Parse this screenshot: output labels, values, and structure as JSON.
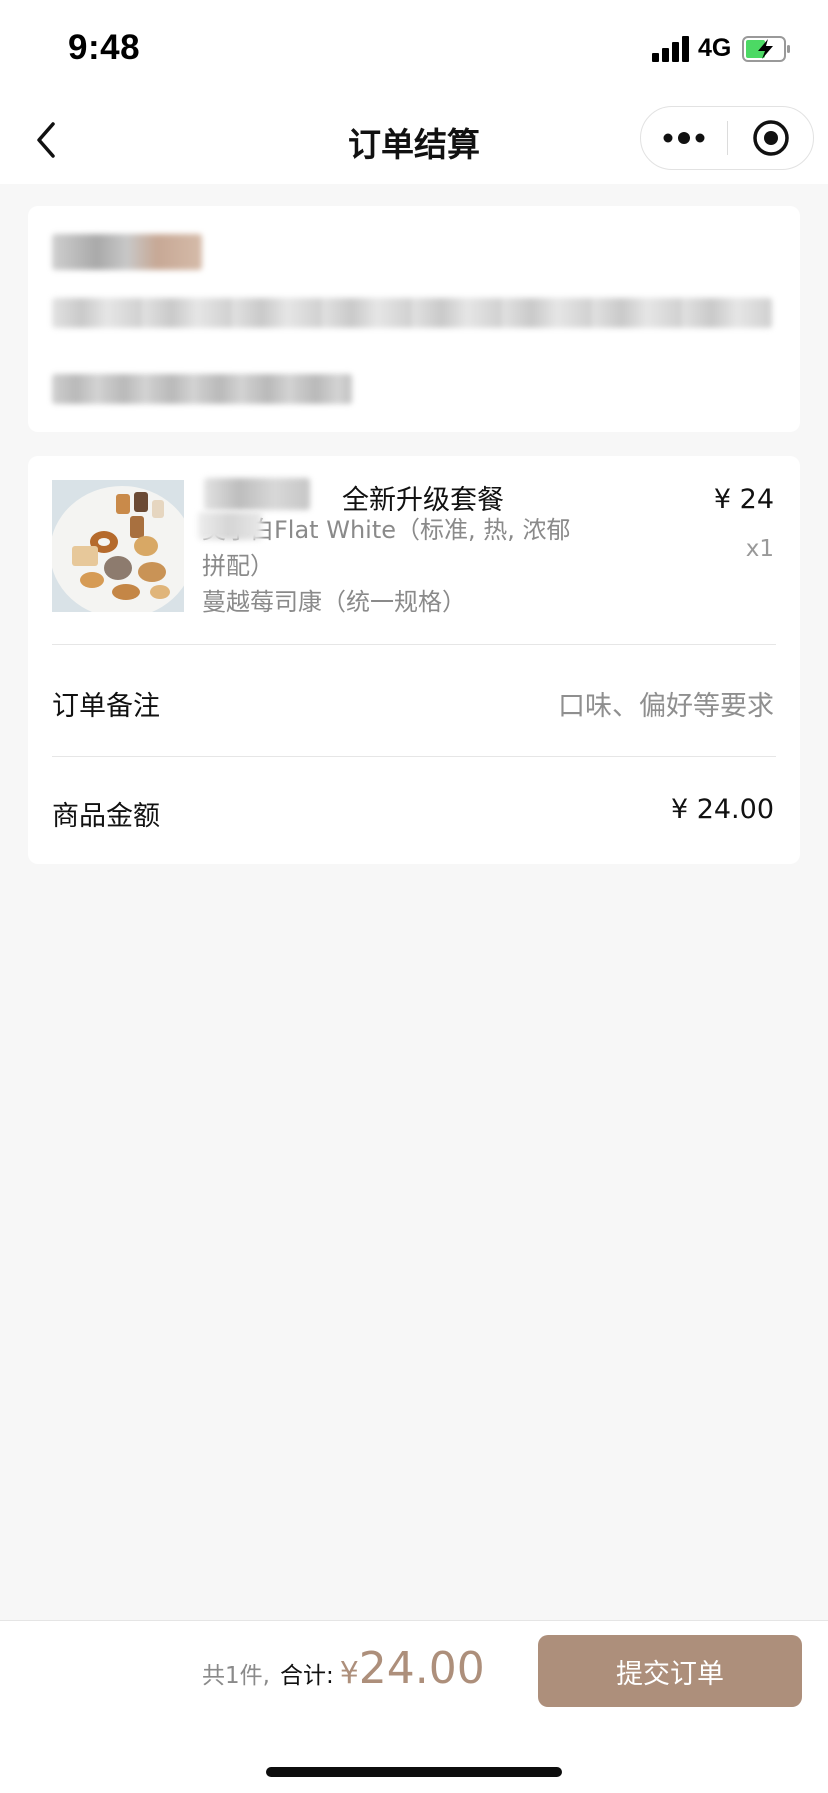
{
  "status_bar": {
    "time": "9:48",
    "network": "4G",
    "signal_icon": "cellular-signal-icon",
    "battery_icon": "battery-charging-icon",
    "battery_color": "#4cd964"
  },
  "nav": {
    "title": "订单结算",
    "back_icon": "chevron-left-icon",
    "more_icon": "more-dots-icon",
    "close_icon": "target-circle-icon"
  },
  "order": {
    "product": {
      "name": "全新升级套餐",
      "desc_line1": "奥小白Flat White（标准, 热, 浓郁",
      "desc_line2": "拼配）",
      "desc_line3": "蔓越莓司康（统一规格）",
      "price": "¥ 24",
      "qty": "x1"
    },
    "remark": {
      "label": "订单备注",
      "placeholder": "口味、偏好等要求"
    },
    "amount": {
      "label": "商品金额",
      "value": "¥ 24.00"
    }
  },
  "footer": {
    "count": "共1件,",
    "total_label": "合计:",
    "currency": "¥",
    "total": "24.00",
    "submit": "提交订单"
  },
  "colors": {
    "accent": "#ad8f7b",
    "background": "#f7f7f7"
  }
}
